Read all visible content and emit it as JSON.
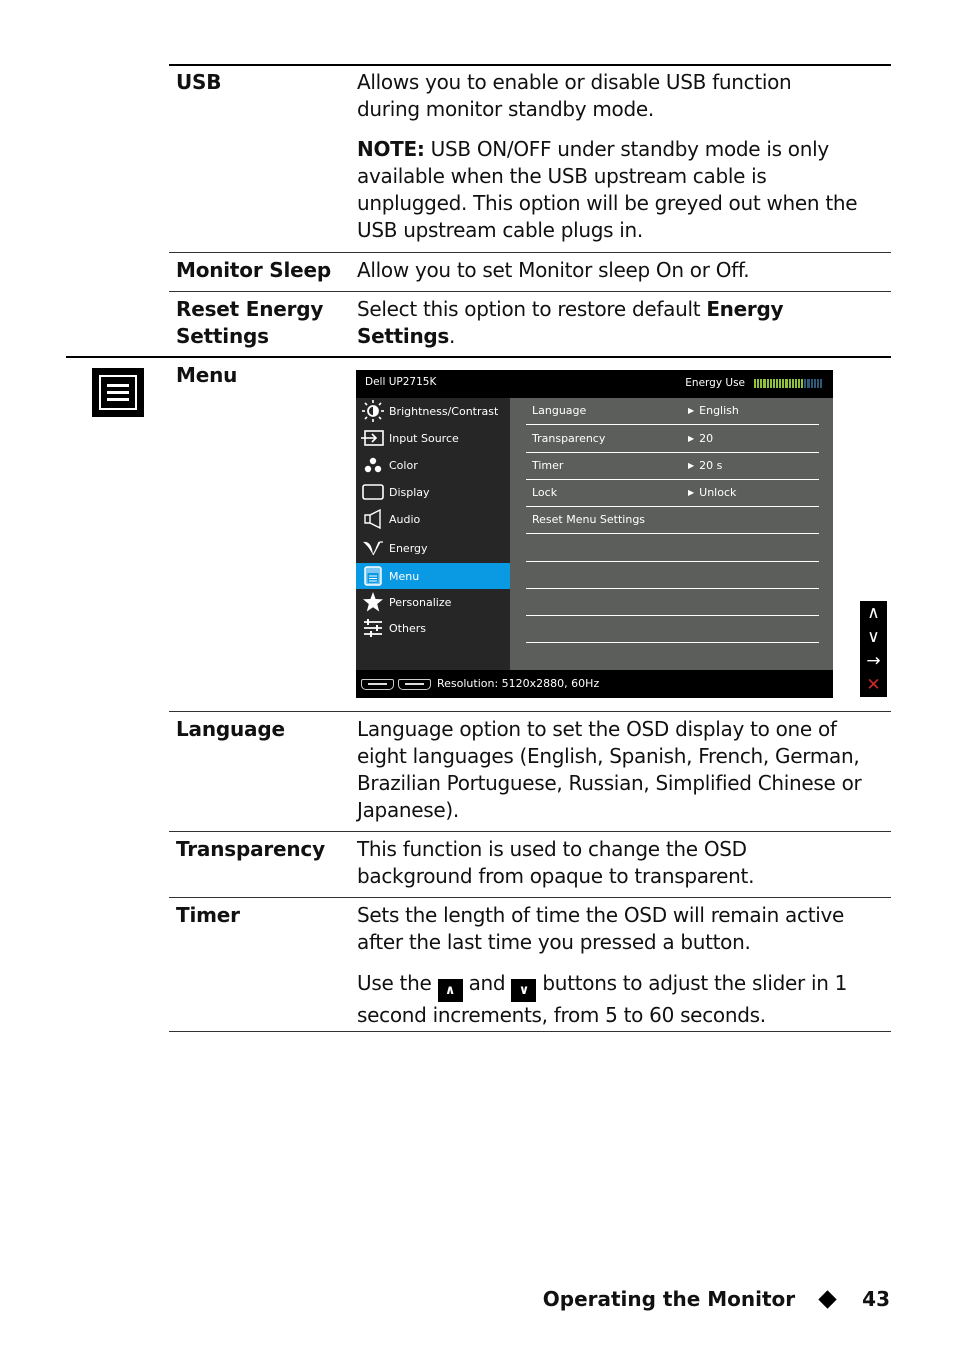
{
  "rows": {
    "usb": {
      "label": "USB",
      "desc": "Allows you to enable or disable USB function during monitor standby mode.",
      "note_label": "NOTE:",
      "note_text": " USB ON/OFF under standby mode is only available when the USB upstream cable is unplugged. This option will be greyed out when the USB upstream cable plugs in."
    },
    "monitor_sleep": {
      "label": "Monitor Sleep",
      "desc": "Allow you to set Monitor sleep On or Off."
    },
    "reset_energy": {
      "label_line1": "Reset Energy",
      "label_line2": "Settings",
      "desc_prefix": "Select this option to restore default ",
      "desc_bold1": "Energy",
      "desc_bold2": "Settings",
      "desc_suffix": "."
    },
    "menu": {
      "label": "Menu",
      "icon": "menu-icon"
    },
    "language": {
      "label": "Language",
      "desc": "Language option to set the OSD display to one of eight languages (English, Spanish, French, German, Brazilian Portuguese, Russian, Simplified Chinese or Japanese)."
    },
    "transparency": {
      "label": "Transparency",
      "desc": "This function is used to change the OSD background from opaque to transparent."
    },
    "timer": {
      "label": "Timer",
      "desc": "Sets the length of time the OSD will remain active after the last time you pressed a button.",
      "desc2_prefix": "Use the ",
      "desc2_mid": " and ",
      "desc2_suffix": " buttons to adjust the slider in 1 second increments, from 5 to 60 seconds.",
      "up_icon": "up-arrow-icon",
      "down_icon": "down-arrow-icon"
    }
  },
  "osd": {
    "title": "Dell UP2715K",
    "energy_label": "Energy Use",
    "energy_level": 0.72,
    "energy_colors": {
      "on": "#8fc13a",
      "off": "#2e5a78"
    },
    "menu_items": [
      {
        "label": "Brightness/Contrast",
        "icon": "brightness-icon"
      },
      {
        "label": "Input Source",
        "icon": "input-source-icon"
      },
      {
        "label": "Color",
        "icon": "color-icon"
      },
      {
        "label": "Display",
        "icon": "display-icon"
      },
      {
        "label": "Audio",
        "icon": "audio-icon"
      },
      {
        "label": "Energy",
        "icon": "energy-icon"
      },
      {
        "label": "Menu",
        "icon": "menu-icon",
        "active": true
      },
      {
        "label": "Personalize",
        "icon": "star-icon"
      },
      {
        "label": "Others",
        "icon": "others-icon"
      }
    ],
    "settings": [
      {
        "key": "Language",
        "value": "English"
      },
      {
        "key": "Transparency",
        "value": "20"
      },
      {
        "key": "Timer",
        "value": "20 s"
      },
      {
        "key": "Lock",
        "value": "Unlock"
      },
      {
        "key": "Reset Menu Settings",
        "value": null
      }
    ],
    "resolution": "Resolution: 5120x2880, 60Hz",
    "accent": "#0a9ae4"
  },
  "nav_buttons": [
    {
      "name": "up-button",
      "glyph": "∧"
    },
    {
      "name": "down-button",
      "glyph": "∨"
    },
    {
      "name": "enter-button",
      "glyph": "→"
    },
    {
      "name": "exit-button",
      "glyph": "✕"
    }
  ],
  "inline_buttons": {
    "up": "∧",
    "down": "∨"
  },
  "footer": {
    "section": "Operating the Monitor",
    "page": "43"
  }
}
